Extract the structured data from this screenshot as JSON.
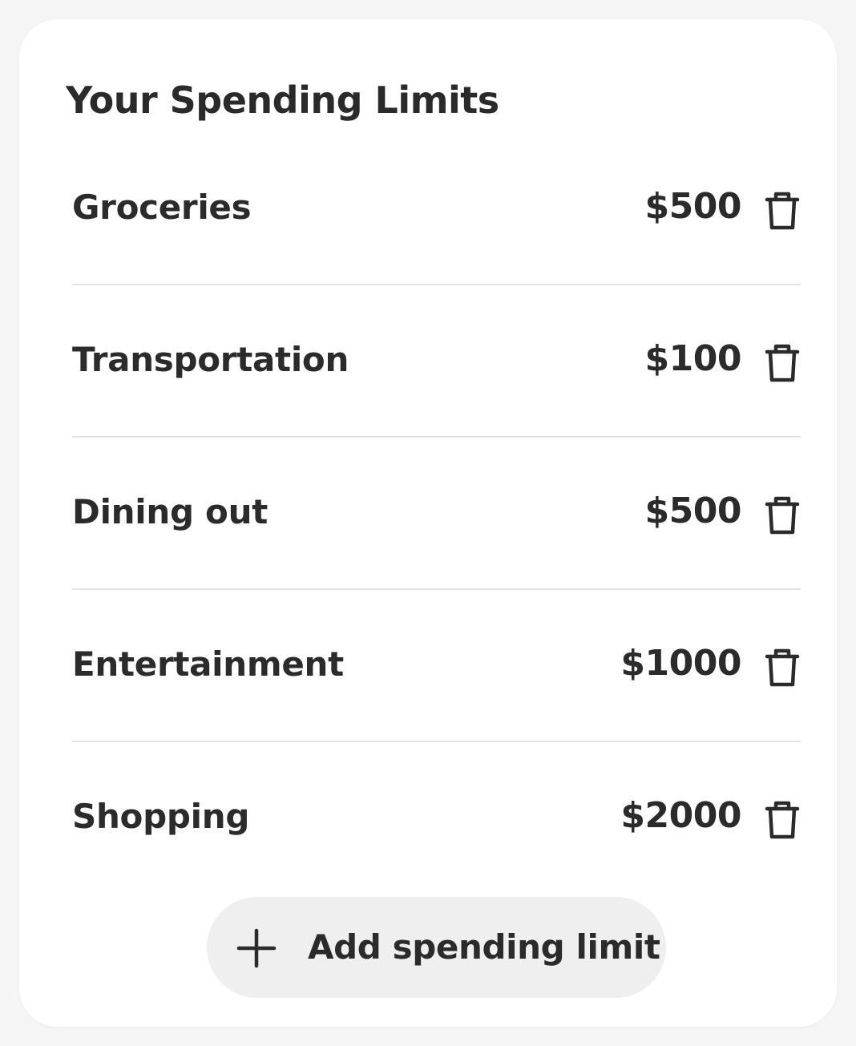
{
  "card": {
    "title": "Your Spending Limits"
  },
  "limits": [
    {
      "category": "Groceries",
      "amount": "$500",
      "icon": "trash-icon"
    },
    {
      "category": "Transportation",
      "amount": "$100",
      "icon": "trash-icon"
    },
    {
      "category": "Dining out",
      "amount": "$500",
      "icon": "trash-icon"
    },
    {
      "category": "Entertainment",
      "amount": "$1000",
      "icon": "trash-icon"
    },
    {
      "category": "Shopping",
      "amount": "$2000",
      "icon": "trash-icon"
    }
  ],
  "add_button": {
    "label": "Add spending limit",
    "icon": "plus-icon"
  },
  "colors": {
    "text": "#2b2b2b",
    "card_background": "#ffffff",
    "page_background": "#f5f5f5",
    "divider": "#e4e4e4",
    "button_background": "#efefef"
  }
}
